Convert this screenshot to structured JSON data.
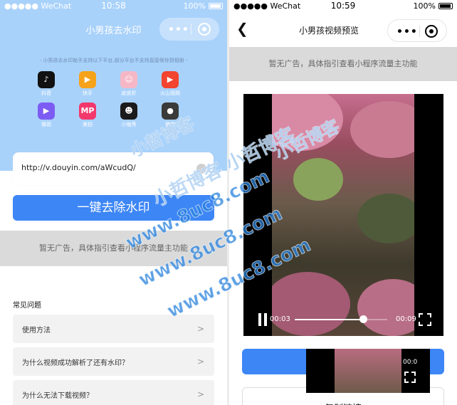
{
  "left": {
    "status": {
      "carrier": "●●●●● WeChat",
      "time": "10:58",
      "battery": "100%"
    },
    "title": "小男孩去水印",
    "notice": "- 小男孩去水印助手支持以下平台,部分平台不支持直接保存到相册 -",
    "apps": [
      {
        "label": "抖音",
        "glyph": "♪",
        "color": "#111111",
        "icon": "douyin-icon"
      },
      {
        "label": "快手",
        "glyph": "▶",
        "color": "#f7a21b",
        "icon": "kuaishou-icon"
      },
      {
        "label": "皮皮虾",
        "glyph": "☺",
        "color": "#f5b7c6",
        "icon": "pipixia-icon"
      },
      {
        "label": "火山视频",
        "glyph": "▶",
        "color": "#f2442e",
        "icon": "huoshan-icon"
      },
      {
        "label": "微视",
        "glyph": "▶",
        "color": "#7c5cf2",
        "icon": "weishi-icon"
      },
      {
        "label": "美拍",
        "glyph": "MP",
        "color": "#f2386c",
        "icon": "meipai-icon"
      },
      {
        "label": "小咖秀",
        "glyph": "☻",
        "color": "#1b1b1b",
        "icon": "xiaokaxiu-icon"
      },
      {
        "label": "微信",
        "glyph": "●",
        "color": "#3a3a3a",
        "icon": "avatar-icon"
      }
    ],
    "url_value": "http://v.douyin.com/aWcudQ/",
    "remove_button": "一键去除水印",
    "ad_text": "暂无广告，具体指引查看小程序流量主功能",
    "faq": {
      "title": "常见问题",
      "items": [
        {
          "q": "使用方法"
        },
        {
          "q": "为什么视频成功解析了还有水印？"
        },
        {
          "q": "为什么无法下载视频？"
        }
      ]
    }
  },
  "right": {
    "status": {
      "carrier": "●●●●● WeChat",
      "time": "10:59",
      "battery": "100%"
    },
    "title": "小男孩视频预览",
    "ad_text": "暂无广告，具体指引查看小程序流量主功能",
    "player": {
      "current": "00:03",
      "duration": "00:09",
      "progress": 0.74
    },
    "copy_button": "复制链接",
    "mini_time": "00:0"
  },
  "watermark": {
    "lines": [
      "小哲博客",
      "小哲博客 小哲博客",
      "www.8uc8.com",
      "www.8uc8.com",
      "www.8uc8.com",
      "小哲博客"
    ],
    "color": "#2882dc"
  }
}
